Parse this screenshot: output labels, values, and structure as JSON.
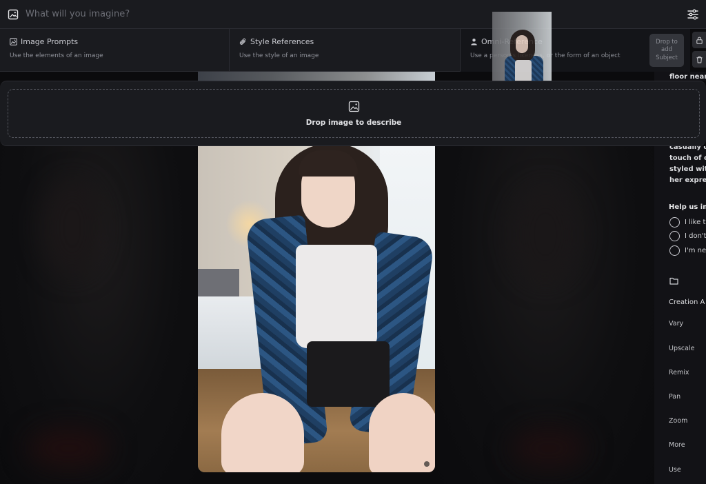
{
  "prompt_bar": {
    "placeholder": "What will you imagine?"
  },
  "references": [
    {
      "title": "Image Prompts",
      "description": "Use the elements of an image"
    },
    {
      "title": "Style References",
      "description": "Use the style of an image"
    },
    {
      "title": "Omni-Reference",
      "description": "Use a person's likeness, or the form of an object"
    }
  ],
  "drop_subject_label": "Drop to add Subject",
  "describe": {
    "label": "Drop image to describe"
  },
  "details": {
    "top_fragment": "floor near a",
    "description_lines": [
      "casually dr",
      "touch of co",
      "styled with",
      "her expres"
    ],
    "feedback_title": "Help us im",
    "feedback_options": [
      "I like th",
      "I don't",
      "I'm ne"
    ],
    "section_title": "Creation A",
    "actions": [
      "Vary",
      "Upscale",
      "Remix",
      "Pan",
      "Zoom",
      "More",
      "Use"
    ]
  }
}
